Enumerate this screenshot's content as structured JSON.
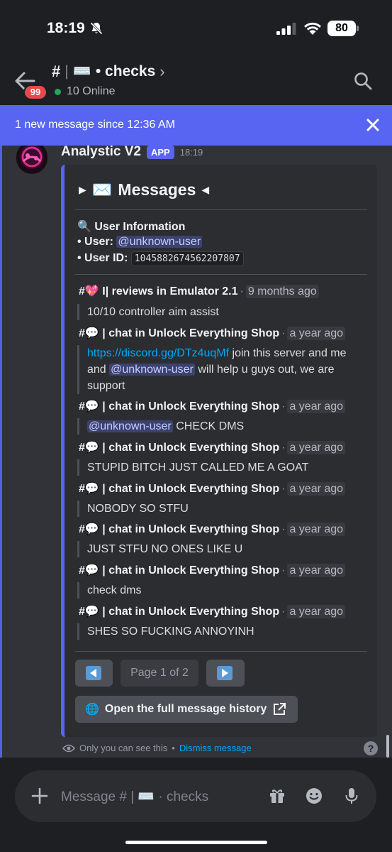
{
  "status_bar": {
    "time": "18:19",
    "battery": "80"
  },
  "header": {
    "unread_badge": "99",
    "channel_hash": "#",
    "channel_separator": "|",
    "channel_emoji": "⌨️",
    "channel_name": "• checks",
    "online_count": "10 Online"
  },
  "new_messages_bar": {
    "text": "1 new message since 12:36 AM"
  },
  "message": {
    "author": "Analystic V2",
    "tag": "APP",
    "time": "18:19",
    "embed": {
      "title_left_marker": "▶",
      "title_emoji": "✉️",
      "title": "Messages",
      "title_right_marker": "◀",
      "user_info_heading": "User Information",
      "user_label": "• User:",
      "user_value": "@unknown-user",
      "userid_label": "• User ID:",
      "userid_value": "1045882674562207807",
      "items": [
        {
          "emoji": "💖",
          "channel": "I| reviews in Emulator 2.1",
          "when": "9 months ago",
          "content": "10/10 controller aim assist"
        },
        {
          "emoji": "💬",
          "channel": "| chat in Unlock Everything Shop",
          "when": "a year ago",
          "link": "https://discord.gg/DTz4uqMf",
          "content_a": "join this server and me and",
          "mention": "@unknown-user",
          "content_b": "will help u guys out, we are support"
        },
        {
          "emoji": "💬",
          "channel": "| chat in Unlock Everything Shop",
          "when": "a year ago",
          "mention": "@unknown-user",
          "content": "CHECK DMS"
        },
        {
          "emoji": "💬",
          "channel": "| chat in Unlock Everything Shop",
          "when": "a year ago",
          "content": "STUPID BITCH JUST CALLED ME A GOAT"
        },
        {
          "emoji": "💬",
          "channel": "| chat in Unlock Everything Shop",
          "when": "a year ago",
          "content": "NOBODY SO STFU"
        },
        {
          "emoji": "💬",
          "channel": "| chat in Unlock Everything Shop",
          "when": "a year ago",
          "content": "JUST STFU NO ONES LIKE U"
        },
        {
          "emoji": "💬",
          "channel": "| chat in Unlock Everything Shop",
          "when": "a year ago",
          "content": "check dms"
        },
        {
          "emoji": "💬",
          "channel": "| chat in Unlock Everything Shop",
          "when": "a year ago",
          "content": "SHES SO FUCKING ANNOYINH"
        }
      ],
      "pager": {
        "page_label": "Page 1 of 2"
      },
      "history_button": {
        "emoji": "🌐",
        "label": "Open the full message history"
      }
    }
  },
  "ephemeral": {
    "text": "Only you can see this",
    "sep": "•",
    "dismiss": "Dismiss message"
  },
  "composer": {
    "placeholder": "Message # | ⌨️ · checks"
  },
  "colors": {
    "blurple": "#5865f2",
    "link": "#00a8fc",
    "danger": "#e5484d",
    "online": "#23a55a"
  },
  "icons": [
    "back-arrow-icon",
    "search-icon",
    "close-icon",
    "plus-icon",
    "gift-icon",
    "emoji-icon",
    "microphone-icon",
    "eye-icon",
    "help-icon",
    "external-link-icon"
  ]
}
